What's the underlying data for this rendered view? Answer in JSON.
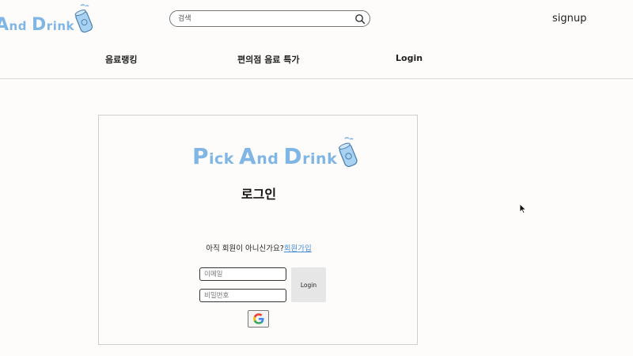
{
  "header": {
    "logo_big_and": "A",
    "logo_small_and": "nd",
    "logo_big_drink": "D",
    "logo_small_drink": "rink",
    "search_placeholder": "검색",
    "signup_label": "signup"
  },
  "nav": {
    "items": [
      {
        "label": "음료랭킹"
      },
      {
        "label": "편의점 음료 특가"
      },
      {
        "label": "Login"
      }
    ]
  },
  "login_card": {
    "logo_p": "P",
    "logo_ick": "ick",
    "logo_a": "A",
    "logo_nd": "nd",
    "logo_d": "D",
    "logo_rink": "rink",
    "title": "로그인",
    "prompt_text": "아직 회원이 아니신가요?",
    "signup_link": "회원가입",
    "email_placeholder": "이메일",
    "password_placeholder": "비밀번호",
    "login_button": "Login"
  },
  "colors": {
    "logo": "#7fb6e6",
    "link": "#4a8fd8",
    "background": "#fdfcfa"
  }
}
